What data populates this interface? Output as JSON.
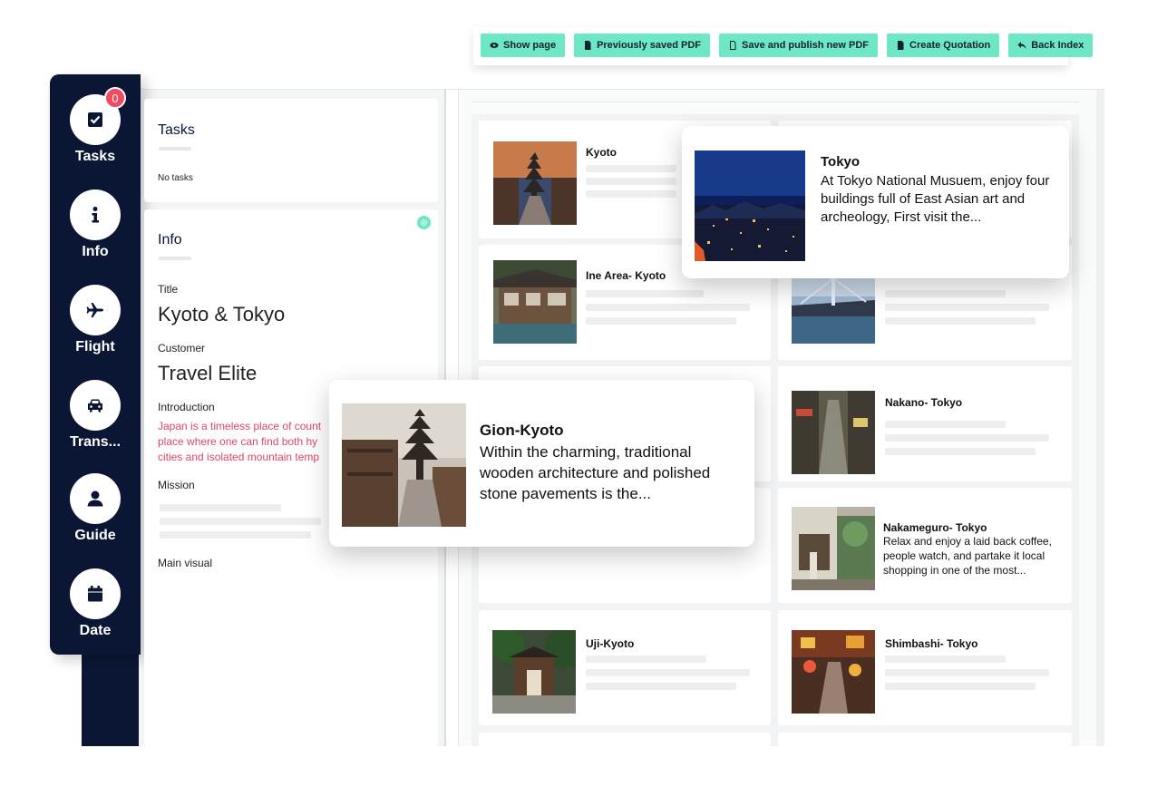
{
  "toolbar": {
    "show_page": "Show page",
    "previously_saved_pdf": "Previously saved PDF",
    "save_publish_pdf": "Save and publish new PDF",
    "create_quotation": "Create Quotation",
    "back_index": "Back Index"
  },
  "sidebar": {
    "tasks_badge": "0",
    "items": [
      {
        "label": "Tasks",
        "icon": "tasks-icon"
      },
      {
        "label": "Info",
        "icon": "info-icon"
      },
      {
        "label": "Flight",
        "icon": "plane-icon"
      },
      {
        "label": "Trans...",
        "icon": "car-icon"
      },
      {
        "label": "Guide",
        "icon": "user-icon"
      },
      {
        "label": "Date",
        "icon": "calendar-icon"
      }
    ]
  },
  "tasks_card": {
    "title": "Tasks",
    "empty_text": "No tasks"
  },
  "info_card": {
    "title": "Info",
    "title_label": "Title",
    "title_value": "Kyoto & Tokyo",
    "customer_label": "Customer",
    "customer_value": "Travel Elite",
    "introduction_label": "Introduction",
    "introduction_lines": [
      "Japan is a timeless place of count",
      "place where one can find both hy",
      "cities and isolated mountain temp"
    ],
    "mission_label": "Mission",
    "main_visual_label": "Main visual"
  },
  "tiles": [
    {
      "title": "Kyoto"
    },
    {
      "title": "Ine Area- Kyoto"
    },
    {
      "title": "Nakano- Tokyo"
    },
    {
      "title": "Nakameguro- Tokyo",
      "description": "Relax and enjoy a laid back coffee, people watch, and partake it local shopping in one of the most..."
    },
    {
      "title": "Uji-Kyoto"
    },
    {
      "title": "Shimbashi- Tokyo"
    }
  ],
  "popups": {
    "tokyo": {
      "title": "Tokyo",
      "description": "At Tokyo National Musuem, enjoy four buildings full of East Asian art and archeology, First visit the..."
    },
    "gion": {
      "title": "Gion-Kyoto",
      "description": "Within the charming, traditional wooden architecture and polished stone pavements is the..."
    }
  },
  "colors": {
    "sidebar": "#0a1634",
    "accent": "#6ee7c5",
    "badge": "#ef4b63",
    "intro_text": "#e0456b"
  }
}
